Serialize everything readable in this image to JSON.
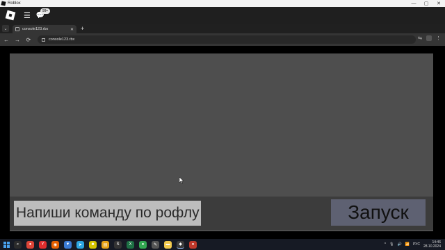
{
  "window": {
    "title": "Roblox",
    "minimize": "—",
    "maximize": "▢",
    "close": "✕"
  },
  "appbar": {
    "menu_icon": "☰",
    "chat_icon": "💬",
    "chat_badge": "99+"
  },
  "tabs": [
    {
      "label": "console123.rbx",
      "close": "✕"
    }
  ],
  "tabbar": {
    "dropdown": "⌄",
    "new_tab": "+"
  },
  "navbar": {
    "back": "←",
    "forward": "→",
    "reload": "⟳",
    "address": "console123.rbx",
    "cast": "⇆",
    "menu": "⋮"
  },
  "game": {
    "command_placeholder": "Напиши команду по рофлу",
    "run_label": "Запуск"
  },
  "taskbar": {
    "apps": [
      {
        "name": "search-icon",
        "glyph": "⌕",
        "color": "#2b2b2b"
      },
      {
        "name": "chrome-icon",
        "glyph": "●",
        "color": "#db4437"
      },
      {
        "name": "yandex-icon",
        "glyph": "Y",
        "color": "#e02d2d"
      },
      {
        "name": "firefox-icon",
        "glyph": "◉",
        "color": "#e66000"
      },
      {
        "name": "defender-icon",
        "glyph": "▼",
        "color": "#3a7bd5"
      },
      {
        "name": "telegram-icon",
        "glyph": "➤",
        "color": "#2ca5e0"
      },
      {
        "name": "bot-icon",
        "glyph": "☻",
        "color": "#d4c400"
      },
      {
        "name": "notes-icon",
        "glyph": "▤",
        "color": "#e8a317"
      },
      {
        "name": "app-icon",
        "glyph": "S",
        "color": "#333"
      },
      {
        "name": "excel-icon",
        "glyph": "X",
        "color": "#1d7044"
      },
      {
        "name": "green-app-icon",
        "glyph": "●",
        "color": "#33a852"
      },
      {
        "name": "edit-icon",
        "glyph": "✎",
        "color": "#555"
      },
      {
        "name": "folder-icon",
        "glyph": "▬",
        "color": "#f2c94c"
      },
      {
        "name": "roblox-icon",
        "glyph": "◆",
        "color": "#3b3b3b"
      },
      {
        "name": "record-icon",
        "glyph": "●",
        "color": "#c0392b"
      }
    ],
    "tray": {
      "chevron": "^",
      "mic": "🎙",
      "volume": "🔊",
      "network": "📶",
      "lang": "РУС",
      "time": "14:46",
      "date": "28.10.2024"
    }
  }
}
